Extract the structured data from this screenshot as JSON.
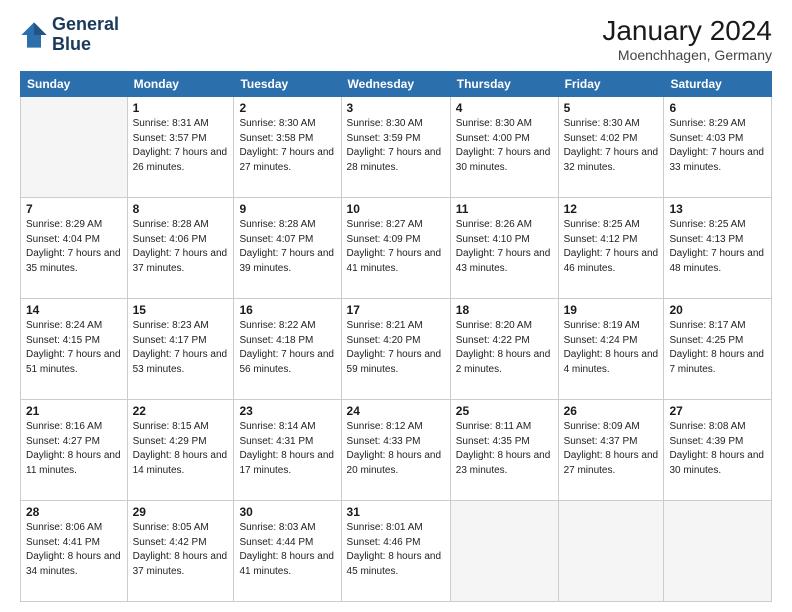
{
  "header": {
    "logo_line1": "General",
    "logo_line2": "Blue",
    "month": "January 2024",
    "location": "Moenchhagen, Germany"
  },
  "weekdays": [
    "Sunday",
    "Monday",
    "Tuesday",
    "Wednesday",
    "Thursday",
    "Friday",
    "Saturday"
  ],
  "weeks": [
    [
      {
        "day": "",
        "sunrise": "",
        "sunset": "",
        "daylight": "",
        "empty": true
      },
      {
        "day": "1",
        "sunrise": "Sunrise: 8:31 AM",
        "sunset": "Sunset: 3:57 PM",
        "daylight": "Daylight: 7 hours and 26 minutes."
      },
      {
        "day": "2",
        "sunrise": "Sunrise: 8:30 AM",
        "sunset": "Sunset: 3:58 PM",
        "daylight": "Daylight: 7 hours and 27 minutes."
      },
      {
        "day": "3",
        "sunrise": "Sunrise: 8:30 AM",
        "sunset": "Sunset: 3:59 PM",
        "daylight": "Daylight: 7 hours and 28 minutes."
      },
      {
        "day": "4",
        "sunrise": "Sunrise: 8:30 AM",
        "sunset": "Sunset: 4:00 PM",
        "daylight": "Daylight: 7 hours and 30 minutes."
      },
      {
        "day": "5",
        "sunrise": "Sunrise: 8:30 AM",
        "sunset": "Sunset: 4:02 PM",
        "daylight": "Daylight: 7 hours and 32 minutes."
      },
      {
        "day": "6",
        "sunrise": "Sunrise: 8:29 AM",
        "sunset": "Sunset: 4:03 PM",
        "daylight": "Daylight: 7 hours and 33 minutes."
      }
    ],
    [
      {
        "day": "7",
        "sunrise": "Sunrise: 8:29 AM",
        "sunset": "Sunset: 4:04 PM",
        "daylight": "Daylight: 7 hours and 35 minutes."
      },
      {
        "day": "8",
        "sunrise": "Sunrise: 8:28 AM",
        "sunset": "Sunset: 4:06 PM",
        "daylight": "Daylight: 7 hours and 37 minutes."
      },
      {
        "day": "9",
        "sunrise": "Sunrise: 8:28 AM",
        "sunset": "Sunset: 4:07 PM",
        "daylight": "Daylight: 7 hours and 39 minutes."
      },
      {
        "day": "10",
        "sunrise": "Sunrise: 8:27 AM",
        "sunset": "Sunset: 4:09 PM",
        "daylight": "Daylight: 7 hours and 41 minutes."
      },
      {
        "day": "11",
        "sunrise": "Sunrise: 8:26 AM",
        "sunset": "Sunset: 4:10 PM",
        "daylight": "Daylight: 7 hours and 43 minutes."
      },
      {
        "day": "12",
        "sunrise": "Sunrise: 8:25 AM",
        "sunset": "Sunset: 4:12 PM",
        "daylight": "Daylight: 7 hours and 46 minutes."
      },
      {
        "day": "13",
        "sunrise": "Sunrise: 8:25 AM",
        "sunset": "Sunset: 4:13 PM",
        "daylight": "Daylight: 7 hours and 48 minutes."
      }
    ],
    [
      {
        "day": "14",
        "sunrise": "Sunrise: 8:24 AM",
        "sunset": "Sunset: 4:15 PM",
        "daylight": "Daylight: 7 hours and 51 minutes."
      },
      {
        "day": "15",
        "sunrise": "Sunrise: 8:23 AM",
        "sunset": "Sunset: 4:17 PM",
        "daylight": "Daylight: 7 hours and 53 minutes."
      },
      {
        "day": "16",
        "sunrise": "Sunrise: 8:22 AM",
        "sunset": "Sunset: 4:18 PM",
        "daylight": "Daylight: 7 hours and 56 minutes."
      },
      {
        "day": "17",
        "sunrise": "Sunrise: 8:21 AM",
        "sunset": "Sunset: 4:20 PM",
        "daylight": "Daylight: 7 hours and 59 minutes."
      },
      {
        "day": "18",
        "sunrise": "Sunrise: 8:20 AM",
        "sunset": "Sunset: 4:22 PM",
        "daylight": "Daylight: 8 hours and 2 minutes."
      },
      {
        "day": "19",
        "sunrise": "Sunrise: 8:19 AM",
        "sunset": "Sunset: 4:24 PM",
        "daylight": "Daylight: 8 hours and 4 minutes."
      },
      {
        "day": "20",
        "sunrise": "Sunrise: 8:17 AM",
        "sunset": "Sunset: 4:25 PM",
        "daylight": "Daylight: 8 hours and 7 minutes."
      }
    ],
    [
      {
        "day": "21",
        "sunrise": "Sunrise: 8:16 AM",
        "sunset": "Sunset: 4:27 PM",
        "daylight": "Daylight: 8 hours and 11 minutes."
      },
      {
        "day": "22",
        "sunrise": "Sunrise: 8:15 AM",
        "sunset": "Sunset: 4:29 PM",
        "daylight": "Daylight: 8 hours and 14 minutes."
      },
      {
        "day": "23",
        "sunrise": "Sunrise: 8:14 AM",
        "sunset": "Sunset: 4:31 PM",
        "daylight": "Daylight: 8 hours and 17 minutes."
      },
      {
        "day": "24",
        "sunrise": "Sunrise: 8:12 AM",
        "sunset": "Sunset: 4:33 PM",
        "daylight": "Daylight: 8 hours and 20 minutes."
      },
      {
        "day": "25",
        "sunrise": "Sunrise: 8:11 AM",
        "sunset": "Sunset: 4:35 PM",
        "daylight": "Daylight: 8 hours and 23 minutes."
      },
      {
        "day": "26",
        "sunrise": "Sunrise: 8:09 AM",
        "sunset": "Sunset: 4:37 PM",
        "daylight": "Daylight: 8 hours and 27 minutes."
      },
      {
        "day": "27",
        "sunrise": "Sunrise: 8:08 AM",
        "sunset": "Sunset: 4:39 PM",
        "daylight": "Daylight: 8 hours and 30 minutes."
      }
    ],
    [
      {
        "day": "28",
        "sunrise": "Sunrise: 8:06 AM",
        "sunset": "Sunset: 4:41 PM",
        "daylight": "Daylight: 8 hours and 34 minutes."
      },
      {
        "day": "29",
        "sunrise": "Sunrise: 8:05 AM",
        "sunset": "Sunset: 4:42 PM",
        "daylight": "Daylight: 8 hours and 37 minutes."
      },
      {
        "day": "30",
        "sunrise": "Sunrise: 8:03 AM",
        "sunset": "Sunset: 4:44 PM",
        "daylight": "Daylight: 8 hours and 41 minutes."
      },
      {
        "day": "31",
        "sunrise": "Sunrise: 8:01 AM",
        "sunset": "Sunset: 4:46 PM",
        "daylight": "Daylight: 8 hours and 45 minutes."
      },
      {
        "day": "",
        "sunrise": "",
        "sunset": "",
        "daylight": "",
        "empty": true
      },
      {
        "day": "",
        "sunrise": "",
        "sunset": "",
        "daylight": "",
        "empty": true
      },
      {
        "day": "",
        "sunrise": "",
        "sunset": "",
        "daylight": "",
        "empty": true
      }
    ]
  ]
}
